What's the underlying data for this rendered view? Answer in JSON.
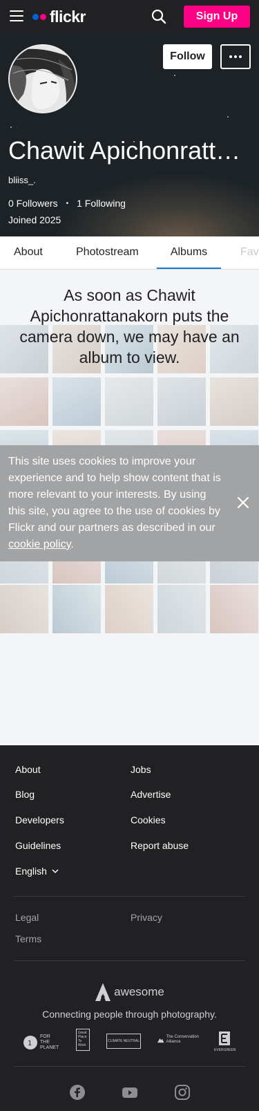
{
  "header": {
    "logo_text": "flickr",
    "signup_label": "Sign Up",
    "brand_colors": {
      "pink": "#ff0084",
      "blue": "#0063dc"
    }
  },
  "profile": {
    "name": "Chawit Apichonrattanakorn",
    "handle": "bliiss_.",
    "followers": "0 Followers",
    "separator": "•",
    "following": "1 Following",
    "joined": "Joined 2025",
    "follow_label": "Follow"
  },
  "tabs": [
    {
      "label": "About",
      "active": false
    },
    {
      "label": "Photostream",
      "active": false
    },
    {
      "label": "Albums",
      "active": true
    },
    {
      "label": "Faves",
      "active": false
    }
  ],
  "empty_state": {
    "message": "As soon as Chawit Apichonrattanakorn puts the camera down, we may have an album to view."
  },
  "cookie_banner": {
    "text": "This site uses cookies to improve your experience and to help show content that is more relevant to your interests. By using this site, you agree to the use of cookies by Flickr and our partners as described in our",
    "link_text": "cookie policy",
    "trailing": "."
  },
  "footer": {
    "links_left": [
      "About",
      "Blog",
      "Developers",
      "Guidelines"
    ],
    "links_right": [
      "Jobs",
      "Advertise",
      "Cookies",
      "Report abuse"
    ],
    "language": "English",
    "legal_left": [
      "Legal",
      "Terms"
    ],
    "legal_right": [
      "Privacy"
    ],
    "awesome_word": "awesome",
    "tagline": "Connecting people through photography.",
    "partners": [
      {
        "icon": "one-percent-for-the-planet-logo",
        "text": "FOR THE PLANET"
      },
      {
        "icon": "great-place-to-work-logo",
        "text": "Great Place To Work"
      },
      {
        "icon": "climate-neutral-logo",
        "text": "CLIMATE NEUTRAL"
      },
      {
        "icon": "conservation-alliance-logo",
        "text": "The Conservation Alliance"
      },
      {
        "icon": "evergreen-certified-logo",
        "text": "EVERGREEN"
      }
    ],
    "socials": [
      "facebook-icon",
      "youtube-icon",
      "instagram-icon"
    ]
  }
}
